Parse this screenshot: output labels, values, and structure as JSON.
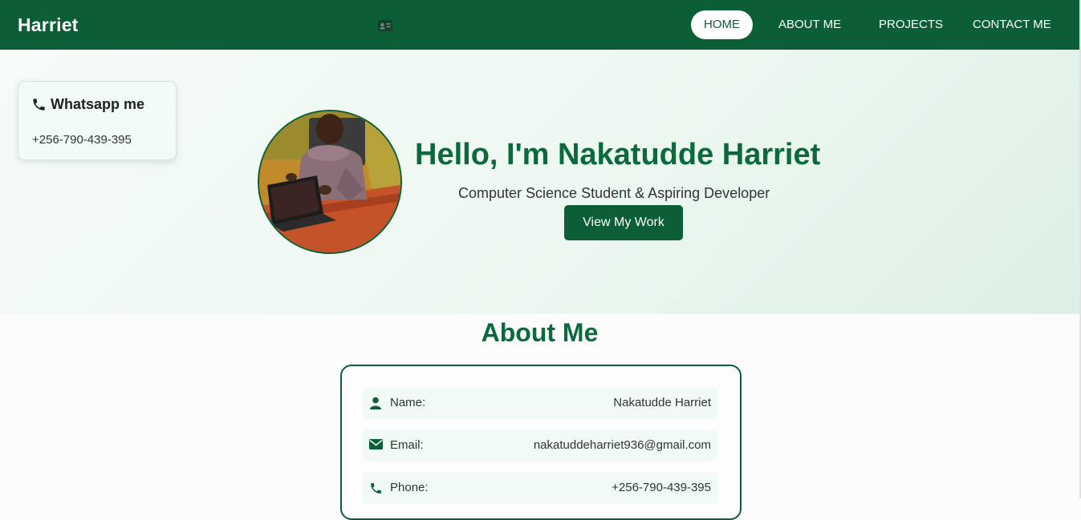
{
  "navbar": {
    "brand": "Harriet",
    "icon": "id-card-icon",
    "links": [
      "HOME",
      "ABOUT ME",
      "PROJECTS",
      "CONTACT ME"
    ],
    "active": "HOME"
  },
  "whatsapp": {
    "title": "Whatsapp me",
    "icon": "phone-icon",
    "number": "+256-790-439-395"
  },
  "hero": {
    "title": "Hello, I'm Nakatudde Harriet",
    "subtitle": "Computer Science Student & Aspiring Developer",
    "cta": "View My Work"
  },
  "about": {
    "title": "About Me",
    "rows": [
      {
        "icon": "user-icon",
        "label": "Name:",
        "value": "Nakatudde Harriet"
      },
      {
        "icon": "envelope-icon",
        "label": "Email:",
        "value": "nakatuddeharriet936@gmail.com"
      },
      {
        "icon": "phone-icon",
        "label": "Phone:",
        "value": "+256-790-439-395"
      }
    ]
  },
  "colors": {
    "primary": "#0b5e36",
    "heading": "#0b6a3b"
  }
}
